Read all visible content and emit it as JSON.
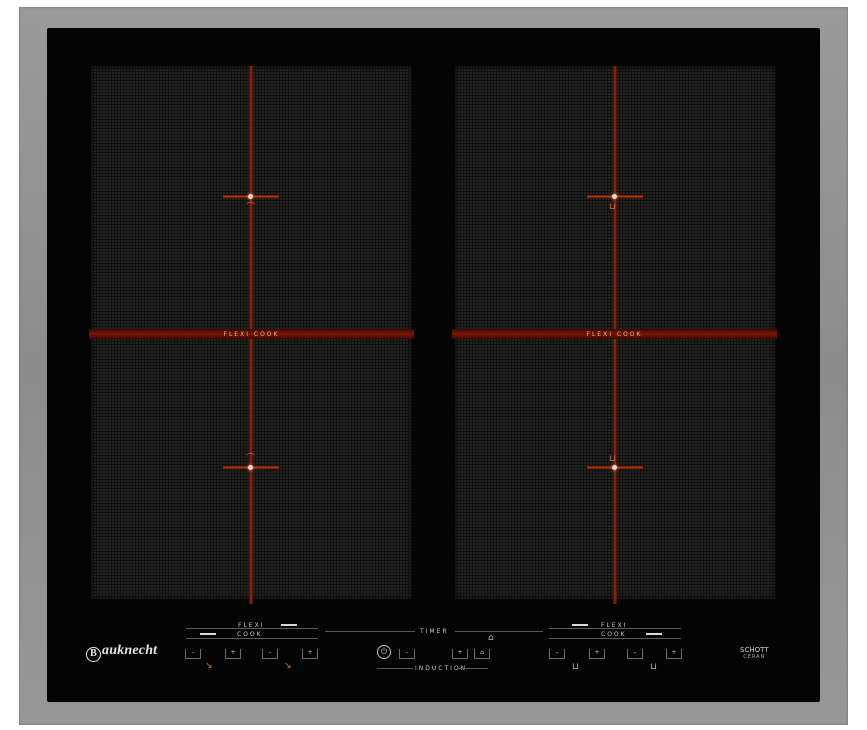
{
  "brand": {
    "initial": "B",
    "rest": "auknecht"
  },
  "glass_maker": {
    "line1": "SCHOTT",
    "line2": "CERAN"
  },
  "zones": {
    "left": {
      "flexi_label": "FLEXI COOK"
    },
    "right": {
      "flexi_label": "FLEXI COOK"
    }
  },
  "controls": {
    "left_group": {
      "line1": "FLEXI",
      "line2": "COOK",
      "keys": [
        "–",
        "+",
        "–",
        "+"
      ]
    },
    "right_group": {
      "line1": "FLEXI",
      "line2": "COOK",
      "keys": [
        "–",
        "+",
        "–",
        "+"
      ]
    },
    "center": {
      "timer_label": "TIMER",
      "induction_label": "INDUCTION",
      "keys": [
        "–",
        "+"
      ],
      "power_symbol": "⏻"
    }
  },
  "colors": {
    "frame": "#8c8c8c",
    "glass": "#040404",
    "zone_marking": "#a02808",
    "icon_orange": "#d8782a"
  },
  "icons": {
    "pot_tilted": "pot-tilted-icon",
    "pot_flat": "pot-icon",
    "power": "power-icon",
    "lock": "lock-icon",
    "timer_symbol": "timer-icon"
  }
}
